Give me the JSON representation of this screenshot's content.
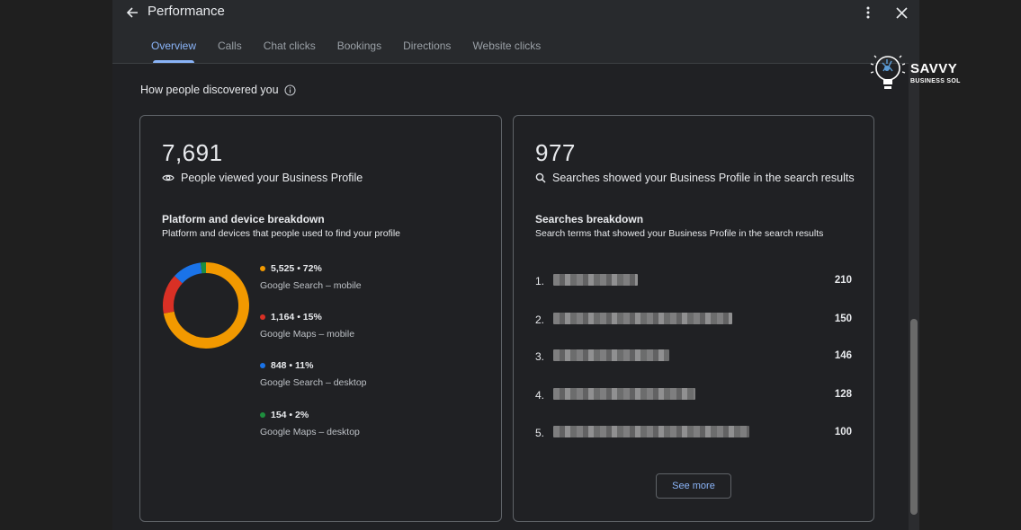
{
  "header": {
    "title": "Performance",
    "tabs": [
      {
        "label": "Overview"
      },
      {
        "label": "Calls"
      },
      {
        "label": "Chat clicks"
      },
      {
        "label": "Bookings"
      },
      {
        "label": "Directions"
      },
      {
        "label": "Website clicks"
      }
    ],
    "active_tab": "Overview"
  },
  "section": {
    "title": "How people discovered you"
  },
  "views_card": {
    "total": "7,691",
    "total_label": "People viewed your Business Profile",
    "breakdown_title": "Platform and device breakdown",
    "breakdown_subtitle": "Platform and devices that people used to find your profile",
    "items": [
      {
        "value": "5,525 • 72%",
        "label": "Google Search – mobile",
        "color": "#f29900",
        "percent": 72
      },
      {
        "value": "1,164 • 15%",
        "label": "Google Maps – mobile",
        "color": "#d93025",
        "percent": 15
      },
      {
        "value": "848 • 11%",
        "label": "Google Search – desktop",
        "color": "#1a73e8",
        "percent": 11
      },
      {
        "value": "154 • 2%",
        "label": "Google Maps – desktop",
        "color": "#1e8e3e",
        "percent": 2
      }
    ]
  },
  "searches_card": {
    "total": "977",
    "total_label": "Searches showed your Business Profile in the search results",
    "breakdown_title": "Searches breakdown",
    "breakdown_subtitle": "Search terms that showed your Business Profile in the search results",
    "rows": [
      {
        "index": "1.",
        "count": "210"
      },
      {
        "index": "2.",
        "count": "150"
      },
      {
        "index": "3.",
        "count": "146"
      },
      {
        "index": "4.",
        "count": "128"
      },
      {
        "index": "5.",
        "count": "100"
      }
    ],
    "see_more": "See more"
  },
  "logo": {
    "name": "SAVVY",
    "sub": "BUSINESS SOL"
  },
  "icons": {
    "back": "arrow-left-icon",
    "more": "more-vert-icon",
    "close": "close-icon",
    "info": "info-icon",
    "eye": "eye-icon",
    "search": "search-icon"
  }
}
